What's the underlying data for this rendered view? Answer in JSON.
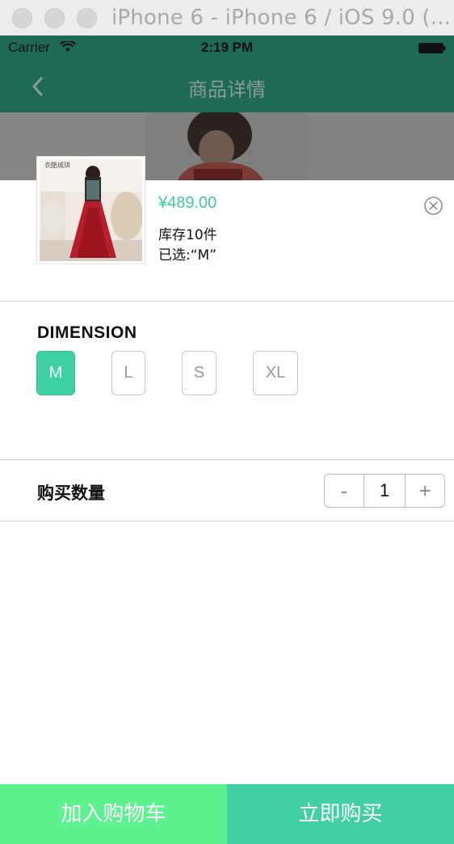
{
  "window": {
    "title": "iPhone 6 - iPhone 6 / iOS 9.0 (..."
  },
  "status_bar": {
    "carrier": "Carrier",
    "time": "2:19 PM"
  },
  "nav": {
    "title": "商品详情",
    "back_icon": "chevron-left-icon"
  },
  "product": {
    "thumb_label": "衣酷城琪",
    "price": "¥489.00",
    "stock": "库存10件",
    "selected": "已选:“M”"
  },
  "dimension": {
    "label": "DIMENSION",
    "options": [
      "M",
      "L",
      "S",
      "XL"
    ],
    "selected": "M"
  },
  "quantity": {
    "label": "购买数量",
    "minus": "-",
    "value": "1",
    "plus": "+"
  },
  "actions": {
    "add_to_cart": "加入购物车",
    "buy_now": "立即购买"
  },
  "colors": {
    "accent": "#3ecfa3",
    "add_cart_bg": "#5ef18f",
    "buy_now_bg": "#43cfa6",
    "nav_bg_dimmed": "#1e6a55"
  }
}
